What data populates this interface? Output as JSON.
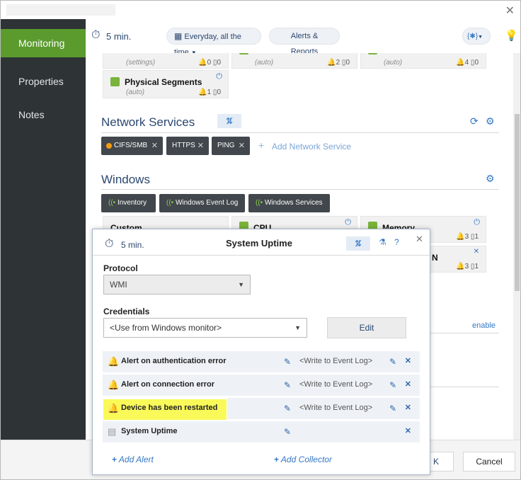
{
  "window": {
    "close_glyph": "✕"
  },
  "sidebar": {
    "items": [
      {
        "label": "Monitoring"
      },
      {
        "label": "Properties"
      },
      {
        "label": "Notes"
      }
    ]
  },
  "toolbar": {
    "interval": "5 min.",
    "schedule": "Everyday, all the time",
    "alerts_reports": "Alerts & Reports",
    "vars_glyph": "{✱}"
  },
  "cards_top": [
    {
      "sub": "(settings)",
      "alerts": "0",
      "docs": "0"
    },
    {
      "sub": "(auto)",
      "alerts": "2",
      "docs": "0"
    },
    {
      "sub": "(auto)",
      "alerts": "4",
      "docs": "0"
    }
  ],
  "physical_segments": {
    "name": "Physical Segments",
    "sub": "(auto)",
    "alerts": "1",
    "docs": "0"
  },
  "network_services": {
    "title": "Network Services",
    "tags": [
      {
        "label": "CIFS/SMB"
      },
      {
        "label": "HTTPS"
      },
      {
        "label": "PING"
      }
    ],
    "add_label": "Add Network Service"
  },
  "windows": {
    "title": "Windows",
    "tags": [
      {
        "label": "Inventory"
      },
      {
        "label": "Windows Event Log"
      },
      {
        "label": "Windows Services"
      }
    ],
    "cards": [
      {
        "name": "Custom"
      },
      {
        "name": "CPU"
      },
      {
        "name": "Memory",
        "alerts": "3",
        "docs": "1"
      },
      {
        "name": "N",
        "alerts": "3",
        "docs": "1"
      }
    ],
    "enable_link": "enable"
  },
  "dialog": {
    "interval": "5 min.",
    "title": "System Uptime",
    "protocol_label": "Protocol",
    "protocol_value": "WMI",
    "credentials_label": "Credentials",
    "credentials_value": "<Use from Windows monitor>",
    "edit_label": "Edit",
    "rows": [
      {
        "name": "Alert on authentication error",
        "action": "<Write to Event Log>"
      },
      {
        "name": "Alert on connection error",
        "action": "<Write to Event Log>"
      },
      {
        "name": "Device has been restarted",
        "action": "<Write to Event Log>"
      },
      {
        "name": "System Uptime",
        "action": ""
      }
    ],
    "add_alert": "Add Alert",
    "add_collector": "Add Collector"
  },
  "footer": {
    "ok_partial": "K",
    "cancel": "Cancel"
  },
  "colors": {
    "accent_green": "#5b9b2e",
    "brand_blue": "#2b4770",
    "link_blue": "#3578c4",
    "highlight": "#f9f95a"
  }
}
